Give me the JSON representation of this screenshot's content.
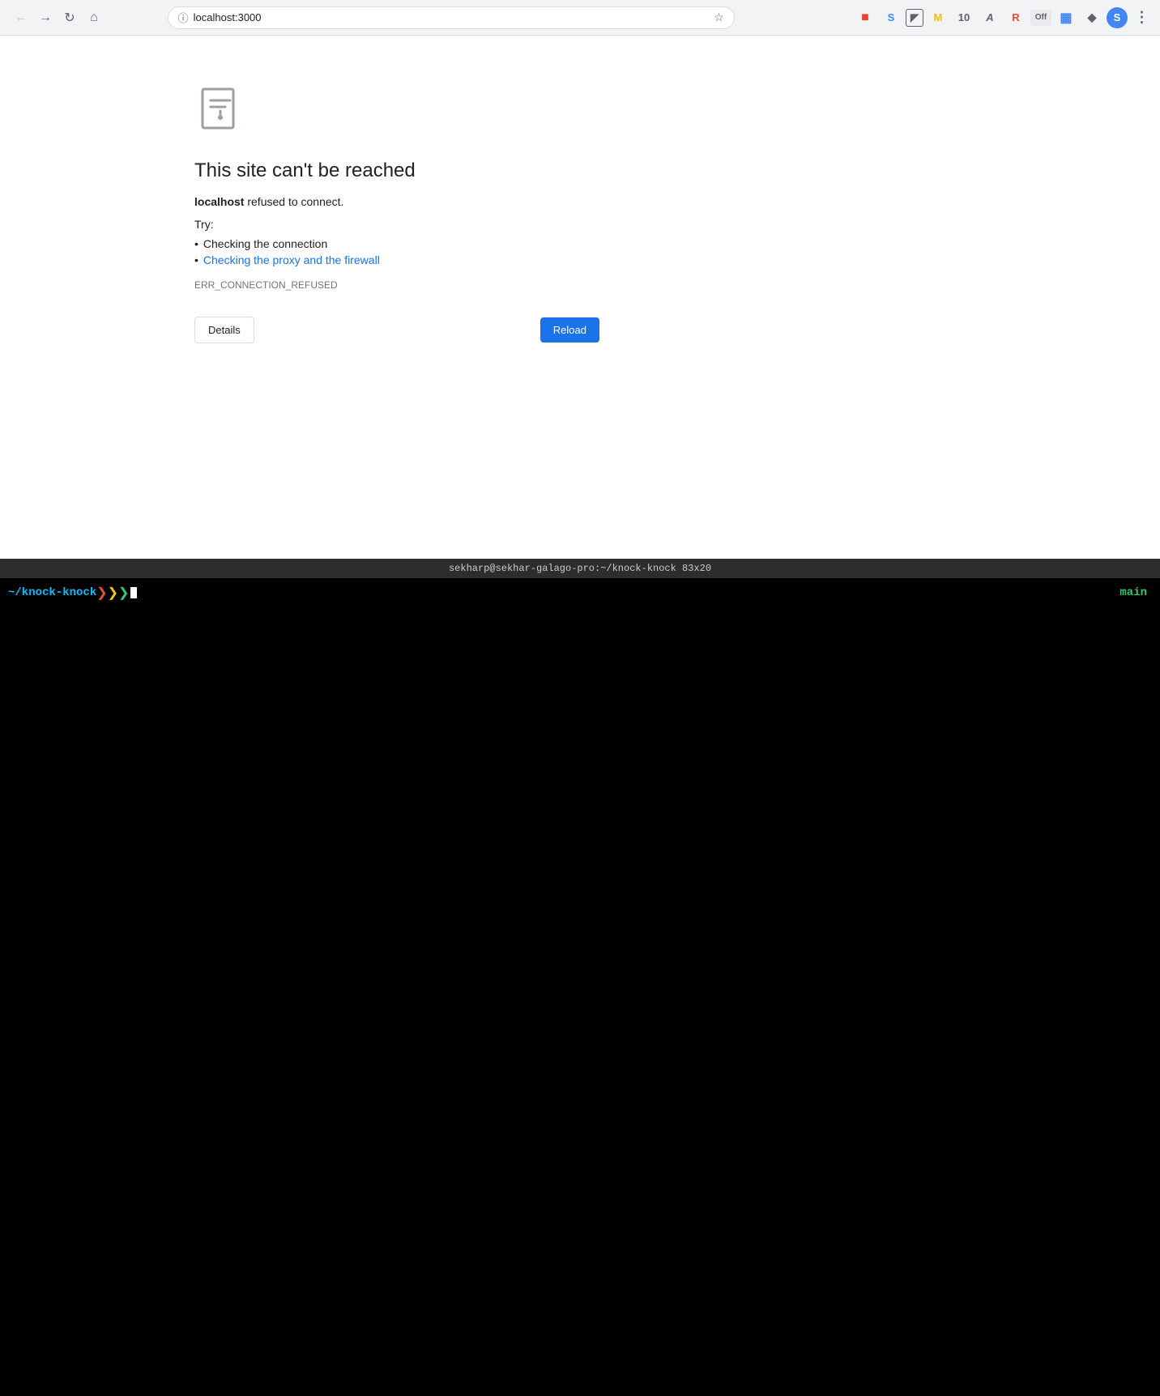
{
  "browser": {
    "url": "localhost:3000",
    "nav": {
      "back_label": "←",
      "forward_label": "→",
      "reload_label": "↺",
      "home_label": "⌂"
    }
  },
  "error_page": {
    "title": "This site can't be reached",
    "host_text": "refused to connect.",
    "host_name": "localhost",
    "try_label": "Try:",
    "suggestion1": "Checking the connection",
    "suggestion2": "Checking the proxy and the firewall",
    "error_code": "ERR_CONNECTION_REFUSED",
    "details_btn": "Details",
    "reload_btn": "Reload"
  },
  "terminal": {
    "status_bar": "sekharp@sekhar-galago-pro:~/knock-knock 83x20",
    "path": "~/knock-knock",
    "branch": "main"
  }
}
